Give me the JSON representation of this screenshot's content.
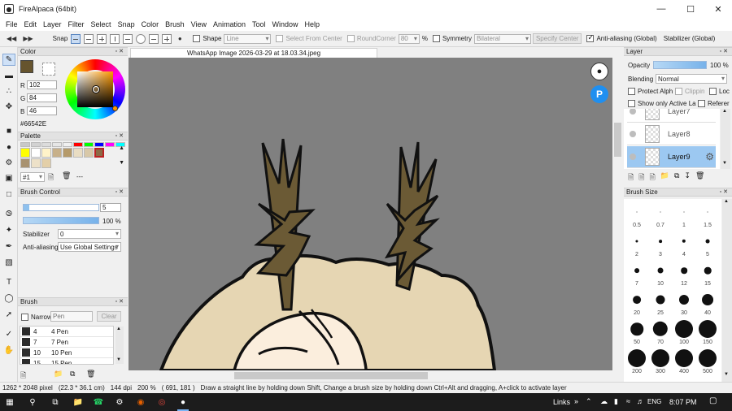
{
  "window": {
    "title": "FireAlpaca (64bit)",
    "minimize_icon": "minimize-icon",
    "maximize_icon": "maximize-icon",
    "close_icon": "close-icon"
  },
  "menu": [
    "File",
    "Edit",
    "Layer",
    "Filter",
    "Select",
    "Snap",
    "Color",
    "Brush",
    "View",
    "Animation",
    "Tool",
    "Window",
    "Help"
  ],
  "toolbar": {
    "snap_label": "Snap",
    "shape_label": "Shape",
    "shape_value": "Line",
    "select_from_center": "Select From Center",
    "roundcorner_label": "RoundCorner",
    "roundcorner_value": "80",
    "percent": "%",
    "symmetry_label": "Symmetry",
    "symmetry_value": "Bilateral",
    "specify_center": "Specify Center",
    "antialias_label": "Anti-aliasing (Global)",
    "stabilizer_label": "Stabilizer (Global)"
  },
  "color_panel": {
    "title": "Color",
    "r_label": "R",
    "r_value": "102",
    "g_label": "G",
    "g_value": "84",
    "b_label": "B",
    "b_value": "46",
    "hex": "#66542E",
    "current_color": "#66542E"
  },
  "palette_panel": {
    "title": "Palette",
    "row1": [
      "#c8c8c8",
      "#d2d2d2",
      "#dcdcdc",
      "#e6e6e6",
      "#f0f0f0",
      "#ff0000",
      "#00ff00",
      "#0000ff",
      "#ff00ff",
      "#00ffff"
    ],
    "row2": [
      "#ffff00",
      "#ffffff",
      "#fff3c9",
      "#c7b08a",
      "#b59a6a",
      "#e9ddc3",
      "#d8c8a8",
      "#8b6a45"
    ],
    "row3": [
      "#a89270",
      "#ede1c8",
      "#e3cfa8"
    ],
    "set_value": "#1",
    "more": "---"
  },
  "brush_control": {
    "title": "Brush Control",
    "size_value": "5",
    "opacity_value": "100 %",
    "stabilizer_label": "Stabilizer",
    "stabilizer_value": "0",
    "antialias_label": "Anti-aliasing",
    "antialias_value": "Use Global Settings"
  },
  "brush_panel": {
    "title": "Brush",
    "narrow_label": "Narrow",
    "search_placeholder": "Pen",
    "clear_label": "Clear",
    "items": [
      {
        "size": "4",
        "name": "4 Pen"
      },
      {
        "size": "7",
        "name": "7 Pen"
      },
      {
        "size": "10",
        "name": "10 Pen"
      },
      {
        "size": "15",
        "name": "15 Pen"
      }
    ]
  },
  "document": {
    "tab_title": "WhatsApp Image 2026-03-29 at 18.03.34.jpeg"
  },
  "layer_panel": {
    "title": "Layer",
    "opacity_label": "Opacity",
    "opacity_value": "100 %",
    "opacity_fraction": 1.0,
    "blending_label": "Blending",
    "blending_value": "Normal",
    "protect_alpha": "Protect Alph",
    "clipping": "Clippin",
    "lock": "Loc",
    "show_only_active": "Show only Active La",
    "reference": "Referer",
    "layers": [
      "Layer7",
      "Layer8",
      "Layer9"
    ],
    "selected_layer": "Layer9"
  },
  "brush_size_panel": {
    "title": "Brush Size",
    "sizes": [
      "0.5",
      "0.7",
      "1",
      "1.5",
      "2",
      "3",
      "4",
      "5",
      "7",
      "10",
      "12",
      "15",
      "20",
      "25",
      "30",
      "40",
      "50",
      "70",
      "100",
      "150",
      "200",
      "300",
      "400",
      "500"
    ]
  },
  "status": {
    "dimensions": "1262 * 2048 pixel",
    "physical": "(22.3 * 36.1 cm)",
    "dpi": "144 dpi",
    "zoom": "200 %",
    "coords": "( 691, 181 )",
    "hint": "Draw a straight line by holding down Shift, Change a brush size by holding down Ctrl+Alt and dragging, A+click to activate layer"
  },
  "taskbar": {
    "links_label": "Links",
    "lang": "ENG",
    "time": "8:07 PM"
  }
}
